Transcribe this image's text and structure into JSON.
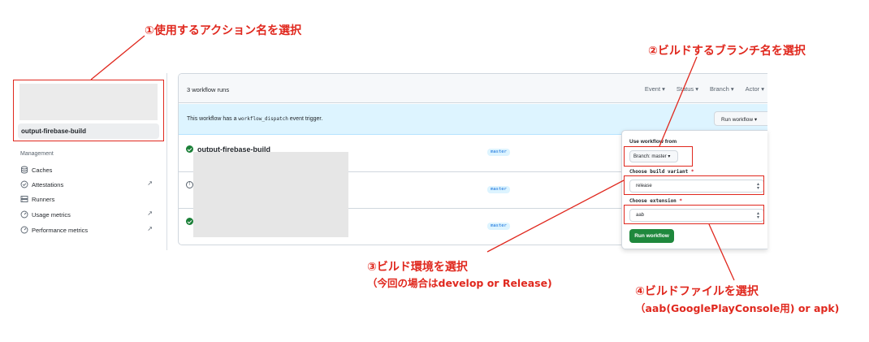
{
  "sidebar": {
    "active_workflow": "output-firebase-build",
    "section_label": "Management",
    "items": [
      {
        "label": "Caches",
        "icon": "database-icon",
        "external": false
      },
      {
        "label": "Attestations",
        "icon": "check-circle-icon",
        "external": true
      },
      {
        "label": "Runners",
        "icon": "server-icon",
        "external": false
      },
      {
        "label": "Usage metrics",
        "icon": "gauge-icon",
        "external": true
      },
      {
        "label": "Performance metrics",
        "icon": "gauge-icon",
        "external": true
      }
    ],
    "external_glyph": "↗"
  },
  "header": {
    "runs_count": "3 workflow runs",
    "filters": [
      "Event ▾",
      "Status ▾",
      "Branch ▾",
      "Actor ▾"
    ]
  },
  "banner": {
    "text_before": "This workflow has a ",
    "code": "workflow_dispatch",
    "text_after": " event trigger.",
    "button": "Run workflow ▾"
  },
  "runs": [
    {
      "title": "output-firebase-build",
      "status": "success",
      "branch": "master"
    },
    {
      "title": "",
      "status": "skipped",
      "branch": "master"
    },
    {
      "title": "",
      "status": "success",
      "branch": "master"
    }
  ],
  "panel": {
    "use_workflow_from": "Use workflow from",
    "branch_button": "Branch: master ▾",
    "build_variant_label": "Choose build variant",
    "build_variant_value": "release",
    "extension_label": "Choose extension",
    "extension_value": "aab",
    "required_mark": "*",
    "run_button": "Run workflow"
  },
  "annotations": {
    "a1": "①使用するアクション名を選択",
    "a2": "②ビルドするブランチ名を選択",
    "a3_main": "③ビルド環境を選択",
    "a3_sub": "（今回の場合はdevelop or Release)",
    "a4_main": "④ビルドファイルを選択",
    "a4_sub": "（aab(GooglePlayConsole用) or apk)"
  },
  "colors": {
    "annotation_red": "#e0281e",
    "success_green": "#1a7f37",
    "primary_button": "#1f883d",
    "banner_blue": "#ddf4ff"
  }
}
